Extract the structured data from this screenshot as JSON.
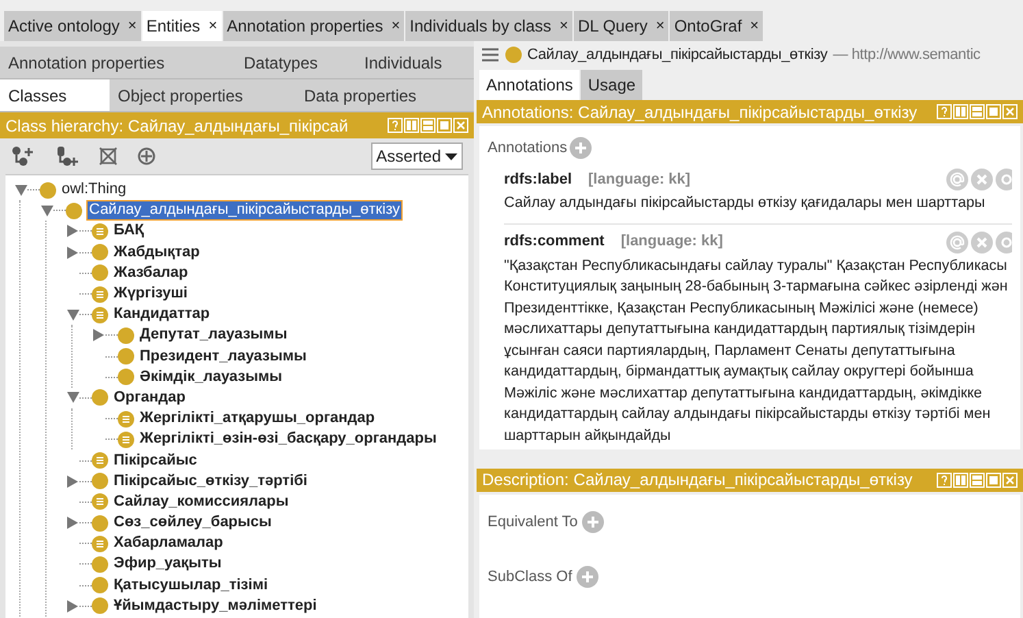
{
  "tabs": [
    {
      "label": "Active ontology",
      "close": "×",
      "selected": false
    },
    {
      "label": "Entities",
      "close": "×",
      "selected": true
    },
    {
      "label": "Annotation properties",
      "close": "×",
      "selected": false
    },
    {
      "label": "Individuals by class",
      "close": "×",
      "selected": false
    },
    {
      "label": "DL Query",
      "close": "×",
      "selected": false
    },
    {
      "label": "OntoGraf",
      "close": "×",
      "selected": false
    }
  ],
  "left": {
    "tab_rows": [
      [
        {
          "label": "Annotation properties",
          "selected": false
        },
        {
          "label": "Datatypes",
          "selected": false
        },
        {
          "label": "Individuals",
          "selected": false
        }
      ],
      [
        {
          "label": "Classes",
          "selected": true
        },
        {
          "label": "Object properties",
          "selected": false
        },
        {
          "label": "Data properties",
          "selected": false
        }
      ]
    ],
    "hierarchy_panel": {
      "title": "Class hierarchy: Сайлау_алдындағы_пікірсай",
      "mode": "Asserted",
      "tree": [
        {
          "label": "owl:Thing",
          "kind": "primitive",
          "expanded": true,
          "selected": false,
          "children": [
            {
              "label": "Сайлау_алдындағы_пікірсайыстарды_өткізу",
              "kind": "primitive",
              "expanded": true,
              "selected": true,
              "children": [
                {
                  "label": "БАҚ",
                  "kind": "defined",
                  "expanded": false,
                  "selected": false
                },
                {
                  "label": "Жабдықтар",
                  "kind": "primitive",
                  "expanded": false,
                  "selected": false
                },
                {
                  "label": "Жазбалар",
                  "kind": "primitive",
                  "selected": false
                },
                {
                  "label": "Жүргізуші",
                  "kind": "defined",
                  "selected": false
                },
                {
                  "label": "Кандидаттар",
                  "kind": "defined",
                  "expanded": true,
                  "selected": false,
                  "children": [
                    {
                      "label": "Депутат_лауазымы",
                      "kind": "primitive",
                      "expanded": false,
                      "selected": false
                    },
                    {
                      "label": "Президент_лауазымы",
                      "kind": "primitive",
                      "selected": false
                    },
                    {
                      "label": "Әкімдік_лауазымы",
                      "kind": "primitive",
                      "selected": false
                    }
                  ]
                },
                {
                  "label": "Органдар",
                  "kind": "primitive",
                  "expanded": true,
                  "selected": false,
                  "children": [
                    {
                      "label": "Жергілікті_атқарушы_органдар",
                      "kind": "defined",
                      "selected": false
                    },
                    {
                      "label": "Жергілікті_өзін-өзі_басқару_органдары",
                      "kind": "defined",
                      "selected": false
                    }
                  ]
                },
                {
                  "label": "Пікірсайыс",
                  "kind": "defined",
                  "selected": false
                },
                {
                  "label": "Пікірсайыс_өткізу_тәртібі",
                  "kind": "primitive",
                  "expanded": false,
                  "selected": false
                },
                {
                  "label": "Сайлау_комиссиялары",
                  "kind": "defined",
                  "selected": false
                },
                {
                  "label": "Сөз_сөйлеу_барысы",
                  "kind": "primitive",
                  "expanded": false,
                  "selected": false
                },
                {
                  "label": "Хабарламалар",
                  "kind": "defined",
                  "selected": false
                },
                {
                  "label": "Эфир_уақыты",
                  "kind": "primitive",
                  "selected": false
                },
                {
                  "label": "Қатысушылар_тізімі",
                  "kind": "primitive",
                  "selected": false
                },
                {
                  "label": "Ұйымдастыру_мәліметтері",
                  "kind": "primitive",
                  "expanded": false,
                  "selected": false
                }
              ]
            }
          ]
        }
      ]
    }
  },
  "entity": {
    "name": "Сайлау_алдындағы_пікірсайыстарды_өткізу",
    "iri": "— http://www.semantic"
  },
  "right_tabs": [
    {
      "label": "Annotations",
      "selected": true
    },
    {
      "label": "Usage",
      "selected": false
    }
  ],
  "annotations_panel": {
    "title": "Annotations: Сайлау_алдындағы_пікірсайыстарды_өткізу",
    "section_label": "Annotations",
    "items": [
      {
        "property": "rdfs:label",
        "language": "[language: kk]",
        "value": "Сайлау алдындағы пікірсайыстарды өткізу қағидалары мен шарттары"
      },
      {
        "property": "rdfs:comment",
        "language": "[language: kk]",
        "value": "\"Қазақстан Республикасындағы сайлау туралы\" Қазақстан Республикасы\nКонституциялық заңының 28-бабының 3-тармағына сәйкес әзірленді жән\nПрезиденттікке, Қазақстан Республикасының Мәжілісі және (немесе)\nмәслихаттары депутаттығына кандидаттардың партиялық тізімдерін\nұсынған саяси партиялардың, Парламент Сенаты депутаттығына\nкандидаттардың, бірмандаттық аумақтық сайлау округтері бойынша\nМәжіліс және мәслихаттар депутаттығына кандидаттардың, әкімдікке\nкандидаттардың сайлау алдындағы пікірсайыстарды өткізу тәртібі мен\nшарттарын айқындайды"
      }
    ]
  },
  "description_panel": {
    "title": "Description: Сайлау_алдындағы_пікірсайыстарды_өткізу",
    "sections": [
      "Equivalent To",
      "SubClass Of"
    ]
  }
}
